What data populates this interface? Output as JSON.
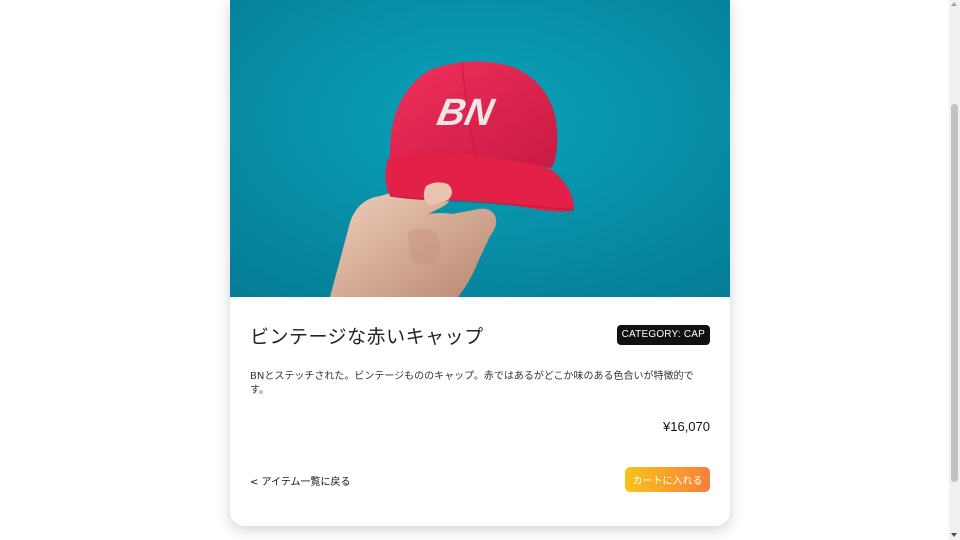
{
  "product": {
    "image": {
      "subject": "hand holding red cap with BN logo",
      "logo_text": "BN",
      "colors": {
        "background": "#0a93aa",
        "cap": "#e8234f",
        "logo": "#efe4e6"
      }
    },
    "title": "ビンテージな赤いキャップ",
    "category_badge": "CATEGORY: CAP",
    "description": "BNとステッチされた。ビンテージもののキャップ。赤ではあるがどこか味のある色合いが特徴的です。",
    "price": "¥16,070"
  },
  "actions": {
    "back_label": "< アイテム一覧に戻る",
    "cart_label": "カートに入れる"
  },
  "theme": {
    "badge_bg": "#111111",
    "button_gradient_start": "#f8c31a",
    "button_gradient_end": "#f7803a"
  },
  "scrollbar": {
    "position": 0.9
  }
}
